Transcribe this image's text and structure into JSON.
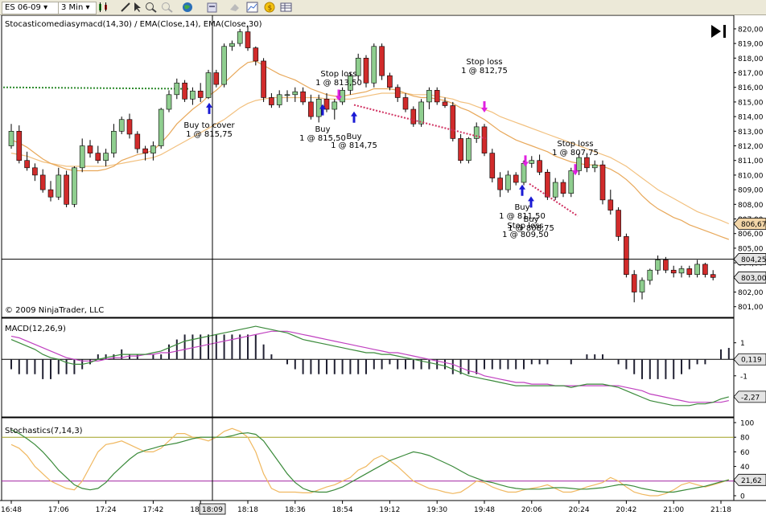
{
  "toolbar": {
    "instrument": "ES 06-09",
    "interval": "3 Min",
    "icons": [
      "candlestick-icon",
      "pencil-icon",
      "cursor-icon",
      "zoom-in-icon",
      "zoom-out-icon",
      "globe-icon",
      "properties-icon",
      "data-box-icon",
      "chart-trader-icon",
      "strategy-icon",
      "coin-icon",
      "table-icon"
    ]
  },
  "price_panel": {
    "title": "Stocasticomediasymacd(14,30) / EMA(Close,14), EMA(Close,30)",
    "copyright": "© 2009 NinjaTrader, LLC",
    "current_price_label": "803,00",
    "cursor_price_label": "804,25",
    "ema14_label": "806,67",
    "y_ticks": [
      "820,00",
      "819,00",
      "818,00",
      "817,00",
      "816,00",
      "815,00",
      "814,00",
      "813,00",
      "812,00",
      "811,00",
      "810,00",
      "809,00",
      "808,00",
      "807,00",
      "806,00",
      "805,00",
      "804,00",
      "803,00",
      "802,00",
      "801,00"
    ]
  },
  "macd_panel": {
    "title": "MACD(12,26,9)",
    "y_ticks": [
      "1",
      "0",
      "-1"
    ],
    "value_label": "0,119",
    "signal_label": "-2,27"
  },
  "stoch_panel": {
    "title": "Stochastics(7,14,3)",
    "y_ticks": [
      "100",
      "80",
      "60",
      "40",
      "20",
      "0"
    ],
    "value_label": "21,62"
  },
  "x_axis": {
    "ticks": [
      "16:48",
      "17:06",
      "17:24",
      "17:42",
      "18:00",
      "18:18",
      "18:36",
      "18:54",
      "19:12",
      "19:30",
      "19:48",
      "20:06",
      "20:24",
      "20:42",
      "21:00",
      "21:18"
    ],
    "cursor_label": "18:09"
  },
  "colors": {
    "up": "#8fce8f",
    "down": "#d12b2b",
    "ema14": "#e8a85a",
    "ema30": "#f2c07e",
    "macd": "#3a8a3a",
    "macd_avg": "#c040c0",
    "stoch_d": "#3a8a3a",
    "stoch_k": "#f0b860",
    "buy_arrow": "#1a1ad4",
    "stop_arrow": "#e020e0"
  },
  "annotations": [
    {
      "line1": "Buy to cover",
      "line2": "1 @ 815,75",
      "kind": "buy"
    },
    {
      "line1": "Stop loss",
      "line2": "1 @ 813,50",
      "kind": "stop"
    },
    {
      "line1": "Buy",
      "line2": "1 @ 815,50",
      "kind": "buy"
    },
    {
      "line1": "Buy",
      "line2": "1 @ 814,75",
      "kind": "buy"
    },
    {
      "line1": "Stop loss",
      "line2": "1 @ 812,75",
      "kind": "stop"
    },
    {
      "line1": "Stop loss",
      "line2": "1 @ 807,75",
      "kind": "stop"
    },
    {
      "line1": "Buy",
      "line2": "1 @ 811,50",
      "kind": "buy"
    },
    {
      "line1": "Stop loss",
      "line2": "1 @ 809,50",
      "kind": "stop"
    },
    {
      "line1": "Buy",
      "line2": "1 @ 808,75",
      "kind": "buy"
    }
  ],
  "chart_data": {
    "type": "candlestick",
    "candles": [
      {
        "o": 812.0,
        "h": 813.5,
        "l": 811.8,
        "c": 813.0
      },
      {
        "o": 813.0,
        "h": 813.4,
        "l": 810.8,
        "c": 811.0
      },
      {
        "o": 811.0,
        "h": 811.6,
        "l": 810.3,
        "c": 810.5
      },
      {
        "o": 810.5,
        "h": 810.8,
        "l": 809.6,
        "c": 810.0
      },
      {
        "o": 810.0,
        "h": 810.4,
        "l": 808.8,
        "c": 809.0
      },
      {
        "o": 809.0,
        "h": 809.6,
        "l": 808.2,
        "c": 808.5
      },
      {
        "o": 808.5,
        "h": 810.5,
        "l": 808.3,
        "c": 810.0
      },
      {
        "o": 810.0,
        "h": 810.3,
        "l": 807.8,
        "c": 808.0
      },
      {
        "o": 808.0,
        "h": 810.6,
        "l": 807.8,
        "c": 810.5
      },
      {
        "o": 810.5,
        "h": 812.5,
        "l": 810.2,
        "c": 812.0
      },
      {
        "o": 812.0,
        "h": 812.4,
        "l": 811.2,
        "c": 811.5
      },
      {
        "o": 811.5,
        "h": 812.0,
        "l": 810.8,
        "c": 811.0
      },
      {
        "o": 811.0,
        "h": 811.8,
        "l": 810.6,
        "c": 811.5
      },
      {
        "o": 811.5,
        "h": 813.5,
        "l": 811.2,
        "c": 813.0
      },
      {
        "o": 813.0,
        "h": 814.0,
        "l": 812.8,
        "c": 813.8
      },
      {
        "o": 813.8,
        "h": 814.2,
        "l": 812.5,
        "c": 812.8
      },
      {
        "o": 812.8,
        "h": 813.0,
        "l": 811.5,
        "c": 811.8
      },
      {
        "o": 811.8,
        "h": 812.0,
        "l": 811.0,
        "c": 811.5
      },
      {
        "o": 811.5,
        "h": 812.3,
        "l": 811.0,
        "c": 812.0
      },
      {
        "o": 812.0,
        "h": 814.6,
        "l": 811.8,
        "c": 814.5
      },
      {
        "o": 814.5,
        "h": 815.8,
        "l": 814.3,
        "c": 815.5
      },
      {
        "o": 815.5,
        "h": 816.6,
        "l": 815.2,
        "c": 816.3
      },
      {
        "o": 816.3,
        "h": 816.5,
        "l": 815.0,
        "c": 815.2
      },
      {
        "o": 815.2,
        "h": 816.0,
        "l": 814.8,
        "c": 815.75
      },
      {
        "o": 815.75,
        "h": 816.3,
        "l": 815.0,
        "c": 815.3
      },
      {
        "o": 815.3,
        "h": 817.2,
        "l": 815.2,
        "c": 817.0
      },
      {
        "o": 817.0,
        "h": 817.2,
        "l": 816.0,
        "c": 816.2
      },
      {
        "o": 816.2,
        "h": 819.0,
        "l": 816.0,
        "c": 818.8
      },
      {
        "o": 818.8,
        "h": 819.2,
        "l": 818.5,
        "c": 819.0
      },
      {
        "o": 819.0,
        "h": 820.0,
        "l": 818.8,
        "c": 819.8
      },
      {
        "o": 819.8,
        "h": 820.2,
        "l": 818.5,
        "c": 818.7
      },
      {
        "o": 818.7,
        "h": 818.8,
        "l": 817.5,
        "c": 817.8
      },
      {
        "o": 817.8,
        "h": 818.0,
        "l": 815.0,
        "c": 815.3
      },
      {
        "o": 815.3,
        "h": 815.6,
        "l": 814.6,
        "c": 814.8
      },
      {
        "o": 814.8,
        "h": 815.8,
        "l": 814.6,
        "c": 815.5
      },
      {
        "o": 815.5,
        "h": 815.8,
        "l": 815.0,
        "c": 815.5
      },
      {
        "o": 815.5,
        "h": 816.0,
        "l": 815.0,
        "c": 815.7
      },
      {
        "o": 815.7,
        "h": 816.0,
        "l": 814.8,
        "c": 815.0
      },
      {
        "o": 815.0,
        "h": 815.5,
        "l": 813.8,
        "c": 814.0
      },
      {
        "o": 814.0,
        "h": 815.5,
        "l": 813.6,
        "c": 815.2
      },
      {
        "o": 815.2,
        "h": 815.6,
        "l": 814.3,
        "c": 814.5
      },
      {
        "o": 814.5,
        "h": 815.2,
        "l": 813.8,
        "c": 815.0
      },
      {
        "o": 815.0,
        "h": 816.0,
        "l": 814.8,
        "c": 815.8
      },
      {
        "o": 815.8,
        "h": 817.0,
        "l": 815.5,
        "c": 816.8
      },
      {
        "o": 816.8,
        "h": 818.3,
        "l": 816.5,
        "c": 818.0
      },
      {
        "o": 818.0,
        "h": 818.2,
        "l": 816.0,
        "c": 816.3
      },
      {
        "o": 816.3,
        "h": 819.0,
        "l": 816.0,
        "c": 818.8
      },
      {
        "o": 818.8,
        "h": 819.0,
        "l": 816.5,
        "c": 816.8
      },
      {
        "o": 816.8,
        "h": 817.0,
        "l": 815.8,
        "c": 816.0
      },
      {
        "o": 816.0,
        "h": 816.2,
        "l": 815.0,
        "c": 815.3
      },
      {
        "o": 815.3,
        "h": 815.6,
        "l": 814.3,
        "c": 814.5
      },
      {
        "o": 814.5,
        "h": 814.7,
        "l": 813.3,
        "c": 813.5
      },
      {
        "o": 813.5,
        "h": 815.2,
        "l": 813.3,
        "c": 815.0
      },
      {
        "o": 815.0,
        "h": 816.0,
        "l": 814.5,
        "c": 815.8
      },
      {
        "o": 815.8,
        "h": 816.0,
        "l": 814.8,
        "c": 815.0
      },
      {
        "o": 815.0,
        "h": 815.3,
        "l": 814.6,
        "c": 814.75
      },
      {
        "o": 814.75,
        "h": 815.0,
        "l": 812.3,
        "c": 812.5
      },
      {
        "o": 812.5,
        "h": 812.8,
        "l": 810.8,
        "c": 811.0
      },
      {
        "o": 811.0,
        "h": 812.6,
        "l": 810.8,
        "c": 812.5
      },
      {
        "o": 812.5,
        "h": 813.6,
        "l": 812.2,
        "c": 813.3
      },
      {
        "o": 813.3,
        "h": 813.5,
        "l": 811.3,
        "c": 811.5
      },
      {
        "o": 811.5,
        "h": 811.8,
        "l": 809.5,
        "c": 809.8
      },
      {
        "o": 809.8,
        "h": 810.2,
        "l": 808.5,
        "c": 809.0
      },
      {
        "o": 809.0,
        "h": 810.3,
        "l": 808.8,
        "c": 810.0
      },
      {
        "o": 810.0,
        "h": 810.2,
        "l": 809.3,
        "c": 809.5
      },
      {
        "o": 809.5,
        "h": 811.0,
        "l": 809.3,
        "c": 810.8
      },
      {
        "o": 810.8,
        "h": 811.3,
        "l": 810.5,
        "c": 811.0
      },
      {
        "o": 811.0,
        "h": 811.4,
        "l": 810.0,
        "c": 810.2
      },
      {
        "o": 810.2,
        "h": 810.4,
        "l": 808.3,
        "c": 808.5
      },
      {
        "o": 808.5,
        "h": 809.8,
        "l": 808.3,
        "c": 809.5
      },
      {
        "o": 809.5,
        "h": 809.7,
        "l": 808.5,
        "c": 808.75
      },
      {
        "o": 808.75,
        "h": 810.5,
        "l": 808.5,
        "c": 810.3
      },
      {
        "o": 810.3,
        "h": 811.5,
        "l": 810.0,
        "c": 811.2
      },
      {
        "o": 811.2,
        "h": 811.5,
        "l": 810.2,
        "c": 810.5
      },
      {
        "o": 810.5,
        "h": 811.0,
        "l": 810.2,
        "c": 810.7
      },
      {
        "o": 810.7,
        "h": 811.0,
        "l": 808.0,
        "c": 808.3
      },
      {
        "o": 808.3,
        "h": 809.0,
        "l": 807.3,
        "c": 807.6
      },
      {
        "o": 807.6,
        "h": 807.8,
        "l": 805.5,
        "c": 805.8
      },
      {
        "o": 805.8,
        "h": 806.0,
        "l": 803.0,
        "c": 803.2
      },
      {
        "o": 803.2,
        "h": 803.5,
        "l": 801.3,
        "c": 802.0
      },
      {
        "o": 802.0,
        "h": 803.0,
        "l": 801.5,
        "c": 802.8
      },
      {
        "o": 802.8,
        "h": 803.6,
        "l": 802.5,
        "c": 803.5
      },
      {
        "o": 803.5,
        "h": 804.5,
        "l": 803.2,
        "c": 804.2
      },
      {
        "o": 804.2,
        "h": 804.4,
        "l": 803.3,
        "c": 803.5
      },
      {
        "o": 803.5,
        "h": 803.8,
        "l": 803.0,
        "c": 803.3
      },
      {
        "o": 803.3,
        "h": 803.8,
        "l": 803.0,
        "c": 803.6
      },
      {
        "o": 803.6,
        "h": 803.8,
        "l": 803.0,
        "c": 803.2
      },
      {
        "o": 803.2,
        "h": 804.2,
        "l": 803.0,
        "c": 803.9
      },
      {
        "o": 803.9,
        "h": 804.0,
        "l": 803.0,
        "c": 803.2
      },
      {
        "o": 803.2,
        "h": 803.5,
        "l": 802.8,
        "c": 803.0
      }
    ],
    "ema14": [
      812.4,
      812.2,
      811.9,
      811.5,
      811.1,
      810.8,
      810.6,
      810.4,
      810.3,
      810.3,
      810.3,
      810.3,
      810.4,
      810.6,
      811.0,
      811.2,
      811.4,
      811.5,
      811.7,
      812.2,
      812.8,
      813.5,
      814.0,
      814.5,
      814.9,
      815.4,
      815.8,
      816.3,
      816.8,
      817.3,
      817.7,
      817.8,
      817.5,
      817.2,
      816.9,
      816.7,
      816.5,
      816.2,
      815.9,
      815.7,
      815.5,
      815.4,
      815.4,
      815.5,
      815.6,
      815.7,
      815.9,
      815.9,
      815.9,
      815.8,
      815.6,
      815.4,
      815.3,
      815.3,
      815.2,
      815.1,
      814.9,
      814.6,
      814.4,
      814.1,
      813.8,
      813.4,
      813.0,
      812.7,
      812.4,
      812.2,
      812.0,
      811.8,
      811.6,
      811.3,
      811.1,
      810.9,
      810.8,
      810.7,
      810.7,
      810.6,
      810.4,
      810.1,
      809.7,
      809.2,
      808.6,
      808.1,
      807.7,
      807.4,
      807.1,
      806.9,
      806.6,
      806.4,
      806.2,
      806.0,
      805.8,
      805.6
    ],
    "ema30": [
      811.5,
      811.4,
      811.3,
      811.1,
      810.9,
      810.8,
      810.7,
      810.6,
      810.6,
      810.6,
      810.6,
      810.6,
      810.6,
      810.7,
      810.8,
      810.9,
      811.0,
      811.1,
      811.2,
      811.4,
      811.7,
      812.0,
      812.3,
      812.6,
      812.9,
      813.2,
      813.5,
      813.8,
      814.2,
      814.6,
      814.9,
      815.1,
      815.2,
      815.3,
      815.3,
      815.3,
      815.3,
      815.3,
      815.3,
      815.3,
      815.2,
      815.2,
      815.2,
      815.2,
      815.3,
      815.4,
      815.5,
      815.6,
      815.6,
      815.6,
      815.6,
      815.5,
      815.5,
      815.5,
      815.4,
      815.3,
      815.2,
      815.0,
      814.9,
      814.7,
      814.5,
      814.3,
      814.0,
      813.8,
      813.6,
      813.4,
      813.2,
      813.0,
      812.8,
      812.6,
      812.4,
      812.2,
      812.0,
      811.8,
      811.6,
      811.4,
      811.2,
      810.9,
      810.6,
      810.2,
      809.8,
      809.4,
      809.0,
      808.7,
      808.4,
      808.1,
      807.8,
      807.5,
      807.3,
      807.1,
      806.9,
      806.67
    ],
    "y_range": [
      800.6,
      820.6
    ],
    "macd": [
      1.2,
      1.0,
      0.8,
      0.6,
      0.3,
      0.1,
      0.0,
      -0.2,
      -0.3,
      -0.3,
      -0.2,
      0.0,
      0.1,
      0.2,
      0.3,
      0.3,
      0.3,
      0.3,
      0.4,
      0.5,
      0.7,
      0.9,
      1.1,
      1.2,
      1.3,
      1.4,
      1.5,
      1.6,
      1.7,
      1.8,
      1.9,
      2.0,
      1.9,
      1.8,
      1.7,
      1.6,
      1.4,
      1.2,
      1.1,
      1.0,
      0.9,
      0.8,
      0.7,
      0.6,
      0.5,
      0.4,
      0.4,
      0.3,
      0.3,
      0.2,
      0.1,
      0.0,
      -0.1,
      -0.2,
      -0.3,
      -0.4,
      -0.6,
      -0.8,
      -1.0,
      -1.1,
      -1.2,
      -1.3,
      -1.4,
      -1.5,
      -1.6,
      -1.6,
      -1.6,
      -1.6,
      -1.6,
      -1.6,
      -1.6,
      -1.7,
      -1.6,
      -1.5,
      -1.5,
      -1.5,
      -1.6,
      -1.7,
      -1.9,
      -2.1,
      -2.3,
      -2.5,
      -2.6,
      -2.7,
      -2.8,
      -2.8,
      -2.8,
      -2.7,
      -2.7,
      -2.6,
      -2.4,
      -2.27
    ],
    "macd_avg": [
      1.4,
      1.3,
      1.1,
      0.9,
      0.7,
      0.5,
      0.3,
      0.1,
      0.0,
      -0.1,
      -0.1,
      -0.1,
      0.0,
      0.1,
      0.1,
      0.2,
      0.2,
      0.3,
      0.3,
      0.4,
      0.4,
      0.5,
      0.6,
      0.7,
      0.8,
      0.9,
      1.0,
      1.1,
      1.2,
      1.3,
      1.4,
      1.5,
      1.6,
      1.7,
      1.7,
      1.7,
      1.6,
      1.5,
      1.4,
      1.3,
      1.2,
      1.1,
      1.0,
      0.9,
      0.8,
      0.7,
      0.6,
      0.5,
      0.4,
      0.4,
      0.3,
      0.2,
      0.1,
      0.0,
      -0.1,
      -0.2,
      -0.3,
      -0.5,
      -0.7,
      -0.8,
      -1.0,
      -1.1,
      -1.2,
      -1.3,
      -1.4,
      -1.4,
      -1.5,
      -1.5,
      -1.5,
      -1.6,
      -1.6,
      -1.6,
      -1.6,
      -1.6,
      -1.6,
      -1.6,
      -1.6,
      -1.6,
      -1.7,
      -1.8,
      -1.9,
      -2.1,
      -2.2,
      -2.3,
      -2.4,
      -2.5,
      -2.6,
      -2.6,
      -2.6,
      -2.6,
      -2.6,
      -2.5
    ],
    "macd_range": [
      -3.2,
      2.2
    ],
    "stoch_k": [
      70,
      65,
      55,
      40,
      30,
      20,
      15,
      10,
      8,
      20,
      40,
      60,
      70,
      72,
      75,
      70,
      65,
      60,
      60,
      65,
      75,
      85,
      85,
      80,
      78,
      75,
      80,
      88,
      92,
      88,
      80,
      60,
      30,
      10,
      5,
      5,
      5,
      4,
      4,
      8,
      12,
      15,
      20,
      25,
      35,
      40,
      50,
      55,
      48,
      40,
      30,
      20,
      15,
      10,
      8,
      5,
      3,
      5,
      12,
      20,
      18,
      12,
      8,
      5,
      5,
      8,
      10,
      12,
      15,
      10,
      5,
      5,
      8,
      12,
      15,
      18,
      25,
      20,
      12,
      5,
      2,
      0,
      0,
      3,
      8,
      15,
      18,
      15,
      12,
      15,
      18,
      22
    ],
    "stoch_d": [
      90,
      85,
      78,
      70,
      60,
      48,
      35,
      25,
      15,
      10,
      8,
      10,
      18,
      30,
      40,
      50,
      58,
      62,
      65,
      68,
      70,
      72,
      75,
      78,
      80,
      80,
      80,
      80,
      82,
      85,
      86,
      84,
      75,
      60,
      45,
      30,
      18,
      10,
      6,
      5,
      5,
      8,
      12,
      18,
      24,
      30,
      36,
      42,
      48,
      52,
      56,
      60,
      58,
      55,
      50,
      45,
      40,
      34,
      28,
      24,
      20,
      18,
      15,
      12,
      10,
      9,
      9,
      9,
      10,
      11,
      11,
      10,
      9,
      9,
      10,
      11,
      13,
      15,
      15,
      13,
      10,
      8,
      6,
      5,
      5,
      7,
      9,
      11,
      13,
      16,
      19,
      21.62
    ],
    "stoch_range": [
      0,
      100
    ]
  }
}
